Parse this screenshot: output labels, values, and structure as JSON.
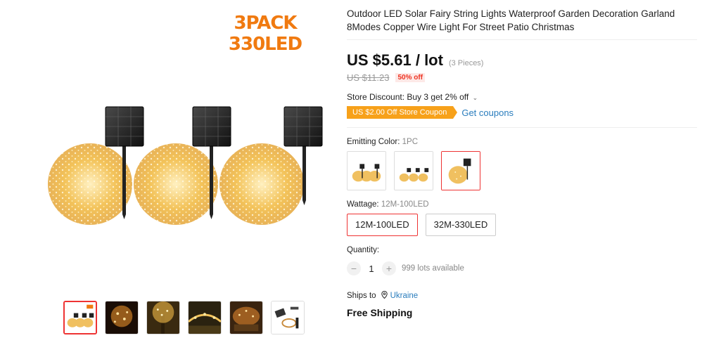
{
  "gallery": {
    "promo_line1": "3PACK",
    "promo_line2": "330LED",
    "thumbnails": [
      "thumb-3pack",
      "thumb-night-lights",
      "thumb-tree-lights",
      "thumb-garden-lights",
      "thumb-patio-lights",
      "thumb-product-parts"
    ],
    "selected_thumbnail": 0
  },
  "product": {
    "title": "Outdoor LED Solar Fairy String Lights Waterproof Garden Decoration Garland 8Modes Copper Wire Light For Street Patio Christmas",
    "price": "US $5.61 / lot",
    "quantity_note": "(3 Pieces)",
    "original_price": "US $11.23",
    "discount": "50% off"
  },
  "store": {
    "discount_text": "Store Discount: Buy 3 get 2% off",
    "coupon_label": "US $2.00 Off Store Coupon",
    "get_coupons_label": "Get coupons"
  },
  "emitting_color": {
    "label": "Emitting Color:",
    "value": "1PC",
    "options": [
      "3pc-option",
      "3pc-small-option",
      "1pc-option"
    ],
    "selected_index": 2
  },
  "wattage": {
    "label": "Wattage:",
    "value": "12M-100LED",
    "options": [
      "12M-100LED",
      "32M-330LED"
    ],
    "selected_index": 0
  },
  "quantity": {
    "label": "Quantity:",
    "minus": "−",
    "value": "1",
    "plus": "+",
    "available": "999 lots available"
  },
  "shipping": {
    "ships_to_label": "Ships to",
    "country": "Ukraine",
    "free_shipping": "Free Shipping"
  },
  "colors": {
    "accent_red": "#e33333",
    "coupon_orange": "#f7a11a",
    "link_blue": "#2a7dbd",
    "promo_orange": "#f07a10",
    "light_gold": "#f5c860"
  }
}
